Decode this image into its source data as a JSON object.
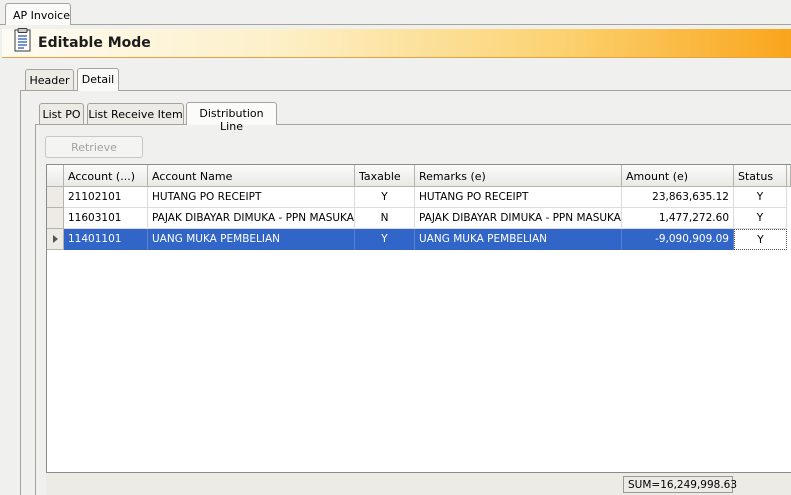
{
  "document_tab": {
    "label": "AP Invoice"
  },
  "banner": {
    "title": "Editable Mode",
    "icon": "document-list-icon"
  },
  "outer_tabs": [
    {
      "label": "Header",
      "active": false
    },
    {
      "label": "Detail",
      "active": true
    }
  ],
  "inner_tabs": [
    {
      "label": "List PO",
      "active": false
    },
    {
      "label": "List Receive Item",
      "active": false
    },
    {
      "label": "Distribution Line",
      "active": true
    }
  ],
  "toolbar": {
    "retrieve_label": "Retrieve",
    "retrieve_enabled": false
  },
  "grid": {
    "columns": [
      "Account (...)",
      "Account Name",
      "Taxable",
      "Remarks (e)",
      "Amount (e)",
      "Status"
    ],
    "rows": [
      {
        "account": "21102101",
        "account_name": "HUTANG PO RECEIPT",
        "taxable": "Y",
        "remarks": "HUTANG PO RECEIPT",
        "amount": "23,863,635.12",
        "status": "Y",
        "selected": false
      },
      {
        "account": "11603101",
        "account_name": "PAJAK DIBAYAR DIMUKA - PPN MASUKAN",
        "taxable": "N",
        "remarks": "PAJAK DIBAYAR DIMUKA - PPN MASUKAN",
        "amount": "1,477,272.60",
        "status": "Y",
        "selected": false
      },
      {
        "account": "11401101",
        "account_name": "UANG MUKA PEMBELIAN",
        "taxable": "Y",
        "remarks": "UANG MUKA PEMBELIAN",
        "amount": "-9,090,909.09",
        "status": "Y",
        "selected": true
      }
    ],
    "footer_sum": "SUM=16,249,998.63"
  },
  "colors": {
    "selection": "#3166c8",
    "banner_accent": "#f9a51c"
  }
}
